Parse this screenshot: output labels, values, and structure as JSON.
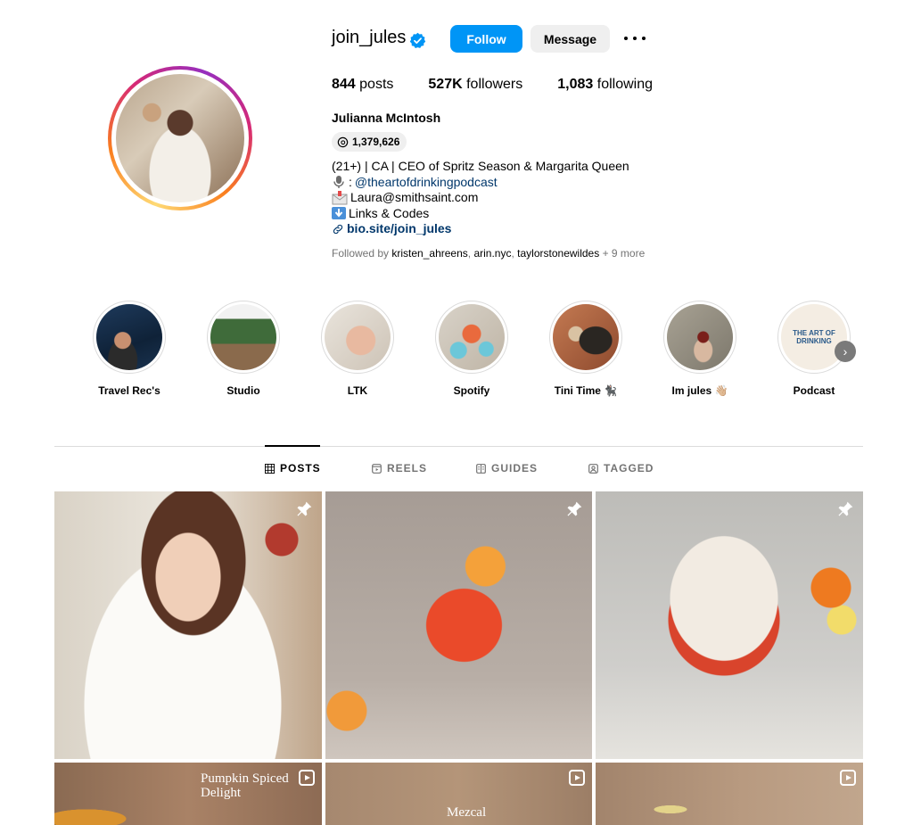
{
  "profile": {
    "username": "join_jules",
    "follow_label": "Follow",
    "message_label": "Message",
    "posts_count": "844",
    "posts_label": "posts",
    "followers_count": "527K",
    "followers_label": "followers",
    "following_count": "1,083",
    "following_label": "following",
    "full_name": "Julianna McIntosh",
    "threads_count": "1,379,626",
    "bio": {
      "line1": "(21+) | CA | CEO of Spritz Season & Margarita Queen",
      "line2_prefix": ":",
      "line2_link": "@theartofdrinkingpodcast",
      "line3": "Laura@smithsaint.com",
      "line4": "Links & Codes",
      "link": "bio.site/join_jules"
    },
    "followed_by": {
      "prefix": "Followed by",
      "user1": "kristen_ahreens",
      "sep1": ",",
      "user2": "arin.nyc",
      "sep2": ",",
      "user3": "taylorstonewildes",
      "more": "+ 9 more"
    }
  },
  "highlights": [
    {
      "label": "Travel Rec's"
    },
    {
      "label": "Studio"
    },
    {
      "label": "LTK"
    },
    {
      "label": "Spotify"
    },
    {
      "label": "Tini Time 🐈‍⬛"
    },
    {
      "label": "Im jules 👋🏼"
    },
    {
      "label": "Podcast",
      "cover_text": "THE ART OF DRINKING"
    }
  ],
  "tabs": [
    {
      "label": "POSTS",
      "active": true,
      "icon": "grid-icon"
    },
    {
      "label": "REELS",
      "active": false,
      "icon": "reels-icon"
    },
    {
      "label": "GUIDES",
      "active": false,
      "icon": "guides-icon"
    },
    {
      "label": "TAGGED",
      "active": false,
      "icon": "tagged-icon"
    }
  ],
  "posts": [
    {
      "type": "photo",
      "pinned": true,
      "caption": ""
    },
    {
      "type": "photo",
      "pinned": true,
      "caption": ""
    },
    {
      "type": "photo",
      "pinned": true,
      "caption": ""
    },
    {
      "type": "reel",
      "pinned": false,
      "caption": "Pumpkin Spiced Delight"
    },
    {
      "type": "reel",
      "pinned": false,
      "caption": "Mezcal"
    },
    {
      "type": "reel",
      "pinned": false,
      "caption": ""
    }
  ],
  "colors": {
    "primary_button": "#0095f6",
    "link": "#00376b",
    "verified_badge": "#0095f6"
  }
}
